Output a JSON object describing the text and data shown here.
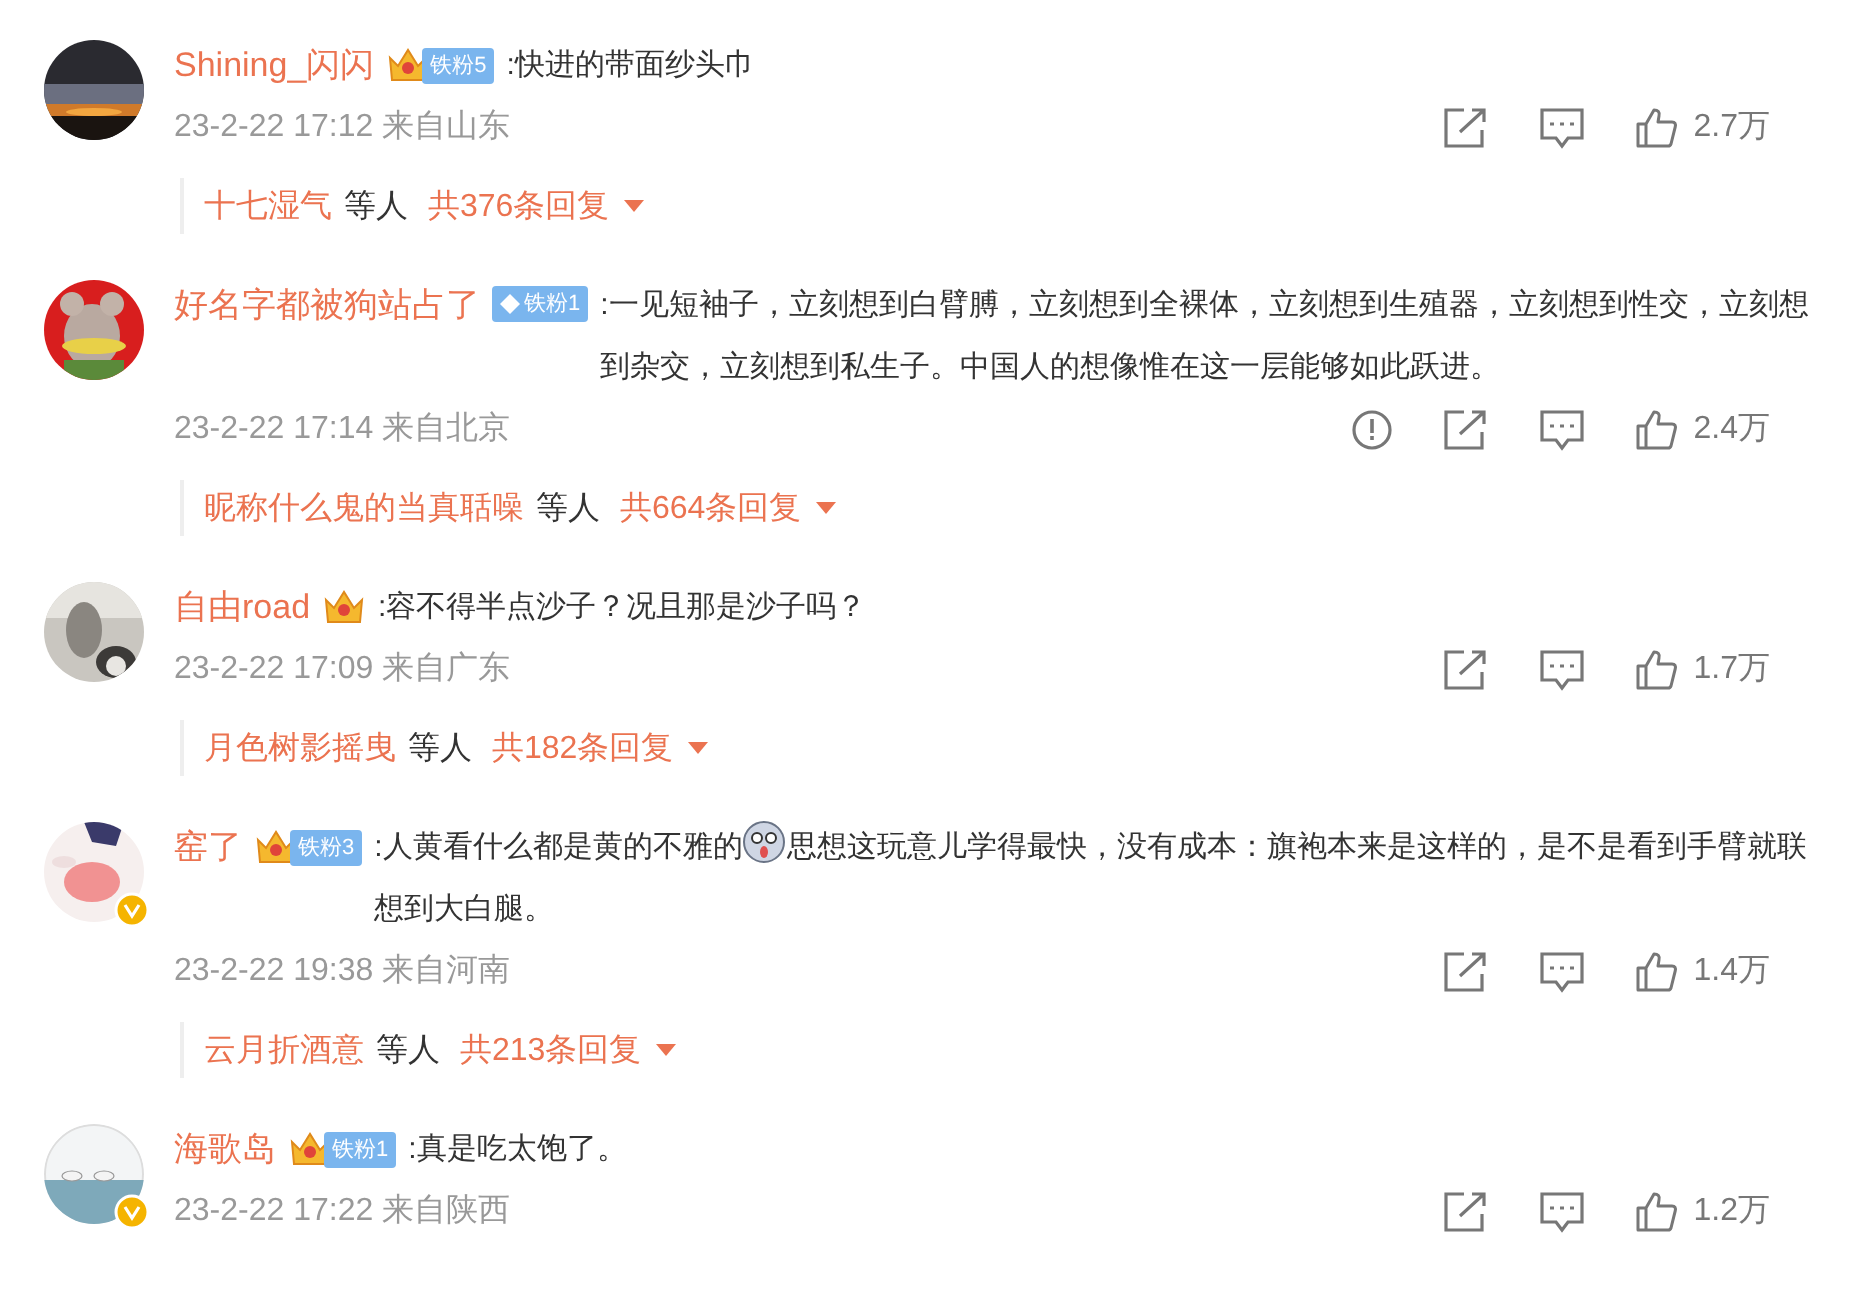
{
  "comments": [
    {
      "user": "Shining_闪闪",
      "verified": false,
      "badge": {
        "kind": "crown",
        "label": "铁粉5"
      },
      "text": [
        {
          "kind": "text",
          "value": ":快进的带面纱头巾"
        }
      ],
      "time": "23-2-22 17:12",
      "location": "来自山东",
      "report": false,
      "likes": "2.7万",
      "replies": {
        "user": "十七湿气",
        "others": "等人",
        "count": "共376条回复"
      }
    },
    {
      "user": "好名字都被狗站占了",
      "verified": false,
      "badge": {
        "kind": "diamond",
        "label": "铁粉1"
      },
      "text": [
        {
          "kind": "text",
          "value": ":一见短袖子，立刻想到白臂膊，立刻想到全裸体，立刻想到生殖器，立刻想到性交，立刻想到杂交，立刻想到私生子。中国人的想像惟在这一层能够如此跃进。"
        }
      ],
      "time": "23-2-22 17:14",
      "location": "来自北京",
      "report": true,
      "likes": "2.4万",
      "replies": {
        "user": "昵称什么鬼的当真聒噪",
        "others": "等人",
        "count": "共664条回复"
      }
    },
    {
      "user": "自由road",
      "verified": false,
      "badge": {
        "kind": "crown"
      },
      "text": [
        {
          "kind": "text",
          "value": ":容不得半点沙子？况且那是沙子吗？"
        }
      ],
      "time": "23-2-22 17:09",
      "location": "来自广东",
      "report": false,
      "likes": "1.7万",
      "replies": {
        "user": "月色树影摇曳",
        "others": "等人",
        "count": "共182条回复"
      }
    },
    {
      "user": "窑了",
      "verified": true,
      "badge": {
        "kind": "crown",
        "label": "铁粉3"
      },
      "text": [
        {
          "kind": "text",
          "value": ":人黄看什么都是黄的不雅的"
        },
        {
          "kind": "emoji"
        },
        {
          "kind": "text",
          "value": "思想这玩意儿学得最快，没有成本：旗袍本来是这样的，是不是看到手臂就联想到大白腿。"
        }
      ],
      "time": "23-2-22 19:38",
      "location": "来自河南",
      "report": false,
      "likes": "1.4万",
      "replies": {
        "user": "云月折酒意",
        "others": "等人",
        "count": "共213条回复"
      }
    },
    {
      "user": "海歌岛",
      "verified": true,
      "badge": {
        "kind": "crown",
        "label": "铁粉1"
      },
      "text": [
        {
          "kind": "text",
          "value": ":真是吃太饱了。"
        }
      ],
      "time": "23-2-22 17:22",
      "location": "来自陕西",
      "report": false,
      "likes": "1.2万"
    }
  ]
}
